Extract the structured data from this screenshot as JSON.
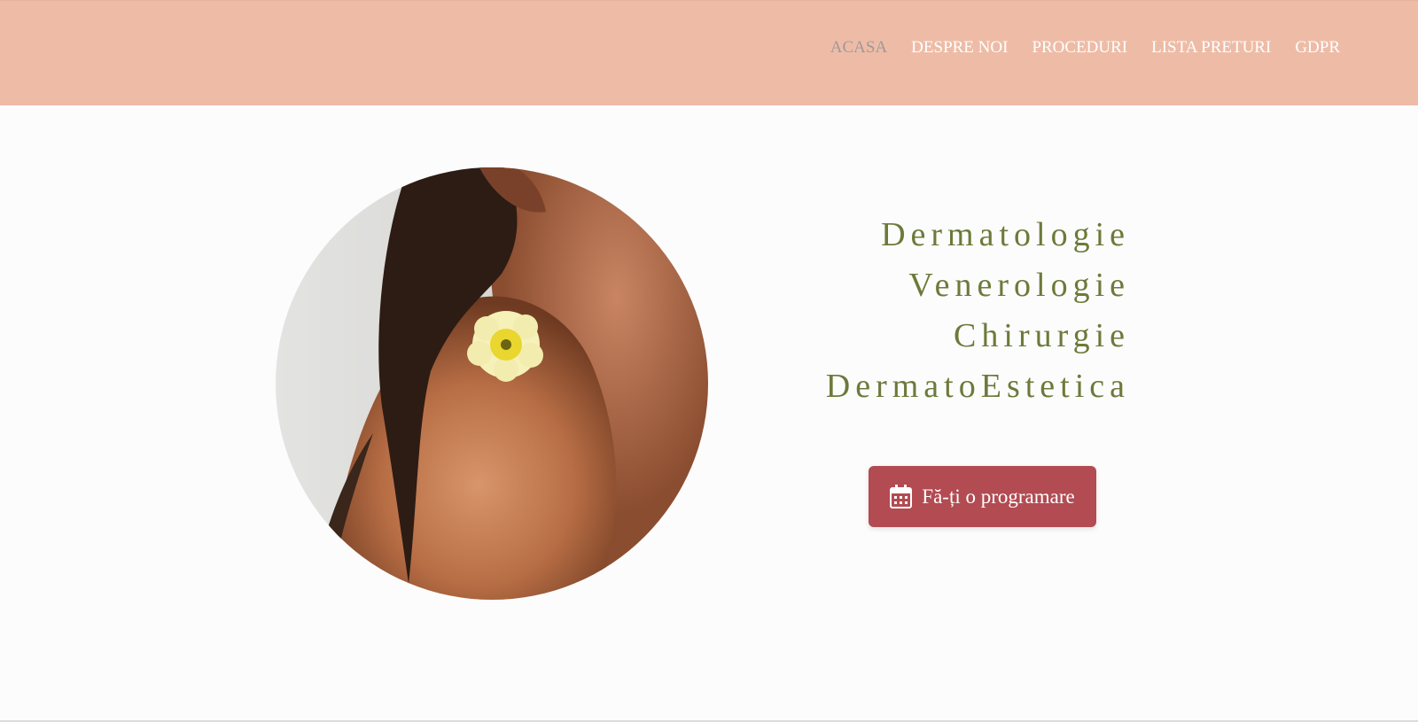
{
  "nav": {
    "items": [
      {
        "label": "ACASA",
        "active": true
      },
      {
        "label": "DESPRE NOI",
        "active": false
      },
      {
        "label": "PROCEDURI",
        "active": false
      },
      {
        "label": "LISTA PRETURI",
        "active": false
      },
      {
        "label": "GDPR",
        "active": false
      }
    ]
  },
  "hero": {
    "specialties": [
      "Dermatologie",
      "Venerologie",
      "Chirurgie",
      "DermatoEstetica"
    ],
    "cta_label": "Fă-ți o programare",
    "cta_icon": "calendar-icon"
  },
  "colors": {
    "header_bg": "#eebca6",
    "nav_text": "#ffffff",
    "nav_active": "#a1989a",
    "specialty_text": "#6c7a3a",
    "cta_bg": "#b24b52"
  }
}
